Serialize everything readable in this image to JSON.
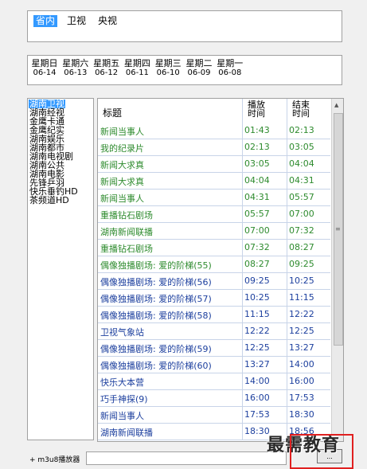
{
  "region_tabs": [
    {
      "label": "省内",
      "selected": true
    },
    {
      "label": "卫视",
      "selected": false
    },
    {
      "label": "央视",
      "selected": false
    }
  ],
  "days": [
    {
      "name": "星期日",
      "date": "06-14"
    },
    {
      "name": "星期六",
      "date": "06-13"
    },
    {
      "name": "星期五",
      "date": "06-12"
    },
    {
      "name": "星期四",
      "date": "06-11"
    },
    {
      "name": "星期三",
      "date": "06-10"
    },
    {
      "name": "星期二",
      "date": "06-09"
    },
    {
      "name": "星期一",
      "date": "06-08"
    }
  ],
  "channels": [
    {
      "label": "湖南卫视",
      "selected": true
    },
    {
      "label": "湖南经视",
      "selected": false
    },
    {
      "label": "金鹰卡通",
      "selected": false
    },
    {
      "label": "金鹰纪实",
      "selected": false
    },
    {
      "label": "湖南娱乐",
      "selected": false
    },
    {
      "label": "湖南都市",
      "selected": false
    },
    {
      "label": "湖南电视剧",
      "selected": false
    },
    {
      "label": "湖南公共",
      "selected": false
    },
    {
      "label": "湖南电影",
      "selected": false
    },
    {
      "label": "先锋乒羽",
      "selected": false
    },
    {
      "label": "快乐垂钓HD",
      "selected": false
    },
    {
      "label": "茶频道HD",
      "selected": false
    }
  ],
  "schedule": {
    "headers": {
      "title": "标题",
      "start": "播放时间",
      "end": "结束时间"
    },
    "colors": {
      "past": "#2e8b2e",
      "future": "#1c3f9e"
    },
    "rows": [
      {
        "title": "新闻当事人",
        "start": "01:43",
        "end": "02:13",
        "past": true
      },
      {
        "title": "我的纪录片",
        "start": "02:13",
        "end": "03:05",
        "past": true
      },
      {
        "title": "新闻大求真",
        "start": "03:05",
        "end": "04:04",
        "past": true
      },
      {
        "title": "新闻大求真",
        "start": "04:04",
        "end": "04:31",
        "past": true
      },
      {
        "title": "新闻当事人",
        "start": "04:31",
        "end": "05:57",
        "past": true
      },
      {
        "title": "重播钻石剧场",
        "start": "05:57",
        "end": "07:00",
        "past": true
      },
      {
        "title": "湖南新闻联播",
        "start": "07:00",
        "end": "07:32",
        "past": true
      },
      {
        "title": "重播钻石剧场",
        "start": "07:32",
        "end": "08:27",
        "past": true
      },
      {
        "title": "偶像独播剧场: 爱的阶梯(55)",
        "start": "08:27",
        "end": "09:25",
        "past": true
      },
      {
        "title": "偶像独播剧场: 爱的阶梯(56)",
        "start": "09:25",
        "end": "10:25",
        "past": false
      },
      {
        "title": "偶像独播剧场: 爱的阶梯(57)",
        "start": "10:25",
        "end": "11:15",
        "past": false
      },
      {
        "title": "偶像独播剧场: 爱的阶梯(58)",
        "start": "11:15",
        "end": "12:22",
        "past": false
      },
      {
        "title": "卫视气象站",
        "start": "12:22",
        "end": "12:25",
        "past": false
      },
      {
        "title": "偶像独播剧场: 爱的阶梯(59)",
        "start": "12:25",
        "end": "13:27",
        "past": false
      },
      {
        "title": "偶像独播剧场: 爱的阶梯(60)",
        "start": "13:27",
        "end": "14:00",
        "past": false
      },
      {
        "title": "快乐大本营",
        "start": "14:00",
        "end": "16:00",
        "past": false
      },
      {
        "title": "巧手神探(9)",
        "start": "16:00",
        "end": "17:53",
        "past": false
      },
      {
        "title": "新闻当事人",
        "start": "17:53",
        "end": "18:30",
        "past": false
      },
      {
        "title": "湖南新闻联播",
        "start": "18:30",
        "end": "18:56",
        "past": false
      }
    ]
  },
  "bottom": {
    "player_label": "+ m3u8播放器",
    "player_value": "",
    "browse_label": "...",
    "watermark": "最需教育"
  }
}
